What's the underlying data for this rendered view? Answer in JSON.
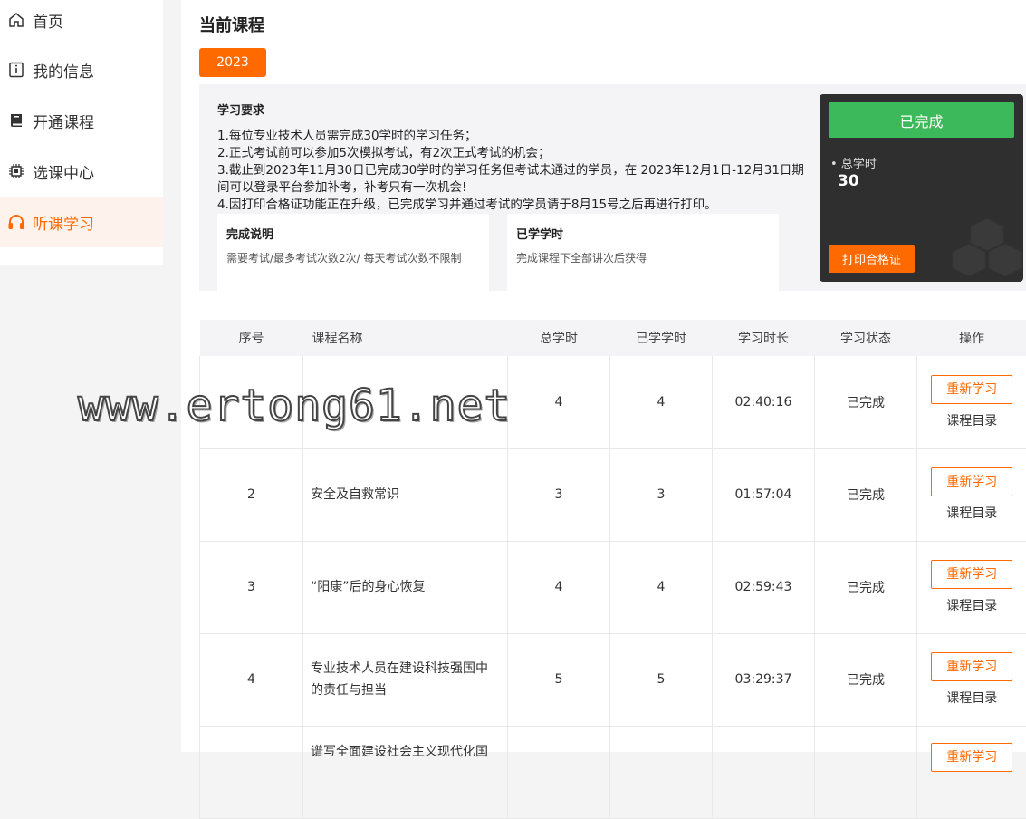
{
  "sidebar": {
    "items": [
      {
        "label": "首页",
        "icon": "home-icon"
      },
      {
        "label": "我的信息",
        "icon": "info-icon"
      },
      {
        "label": "开通课程",
        "icon": "book-icon"
      },
      {
        "label": "选课中心",
        "icon": "chip-icon"
      },
      {
        "label": "听课学习",
        "icon": "headphones-icon",
        "active": true
      }
    ]
  },
  "main": {
    "title": "当前课程",
    "year_tab": "2023",
    "requirements": {
      "title": "学习要求",
      "lines": [
        "1.每位专业技术人员需完成30学时的学习任务；",
        "2.正式考试前可以参加5次模拟考试，有2次正式考试的机会；",
        "3.截止到2023年11月30日已完成30学时的学习任务但考试未通过的学员，在 2023年12月1日-12月31日期间可以登录平台参加补考，补考只有一次机会!",
        "4.因打印合格证功能正在升级，已完成学习并通过考试的学员请于8月15号之后再进行打印。"
      ],
      "cards": [
        {
          "title": "完成说明",
          "desc": "需要考试/最多考试次数2次/ 每天考试次数不限制"
        },
        {
          "title": "已学学时",
          "desc": "完成课程下全部讲次后获得"
        }
      ]
    },
    "status": {
      "state": "已完成",
      "hours_label": "总学时",
      "hours_value": "30",
      "print_label": "打印合格证"
    }
  },
  "table": {
    "headers": [
      "序号",
      "课程名称",
      "总学时",
      "已学学时",
      "学习时长",
      "学习状态",
      "操作"
    ],
    "rows": [
      {
        "no": "",
        "name": "",
        "total": "4",
        "learned": "4",
        "duration": "02:40:16",
        "status": "已完成",
        "action": "重新学习",
        "toc": "课程目录"
      },
      {
        "no": "2",
        "name": "安全及自救常识",
        "total": "3",
        "learned": "3",
        "duration": "01:57:04",
        "status": "已完成",
        "action": "重新学习",
        "toc": "课程目录"
      },
      {
        "no": "3",
        "name": "“阳康”后的身心恢复",
        "total": "4",
        "learned": "4",
        "duration": "02:59:43",
        "status": "已完成",
        "action": "重新学习",
        "toc": "课程目录"
      },
      {
        "no": "4",
        "name": "专业技术人员在建设科技强国中的责任与担当",
        "total": "5",
        "learned": "5",
        "duration": "03:29:37",
        "status": "已完成",
        "action": "重新学习",
        "toc": "课程目录"
      },
      {
        "no": "",
        "name": "谱写全面建设社会主义现代化国",
        "total": "",
        "learned": "",
        "duration": "",
        "status": "",
        "action": "重新学习",
        "toc": ""
      }
    ]
  },
  "watermark": "www.ertong61.net",
  "colors": {
    "accent": "#ff6a00",
    "success": "#3cb95a",
    "dark_panel": "#2f2f2f"
  }
}
